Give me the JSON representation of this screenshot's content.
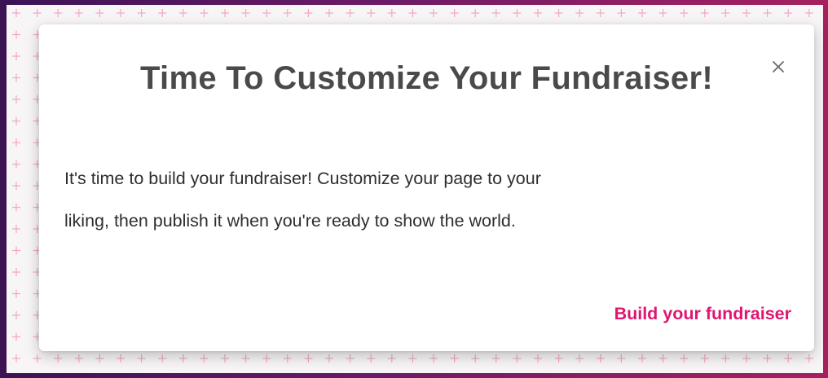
{
  "colors": {
    "frame_left": "#3b1455",
    "frame_right": "#a5205f",
    "backdrop": "#f7f5f6",
    "plus_pattern": "#f2a7c4",
    "title_text": "#4a4a4a",
    "body_text": "#2e2e2e",
    "accent": "#e01570"
  },
  "modal": {
    "title": "Time To Customize Your Fundraiser!",
    "close_icon": "close-icon",
    "body_lines": [
      "It's time to build your fundraiser! Customize your page to your",
      "liking, then publish it when you're ready to show the world."
    ],
    "action_label": "Build your fundraiser"
  }
}
